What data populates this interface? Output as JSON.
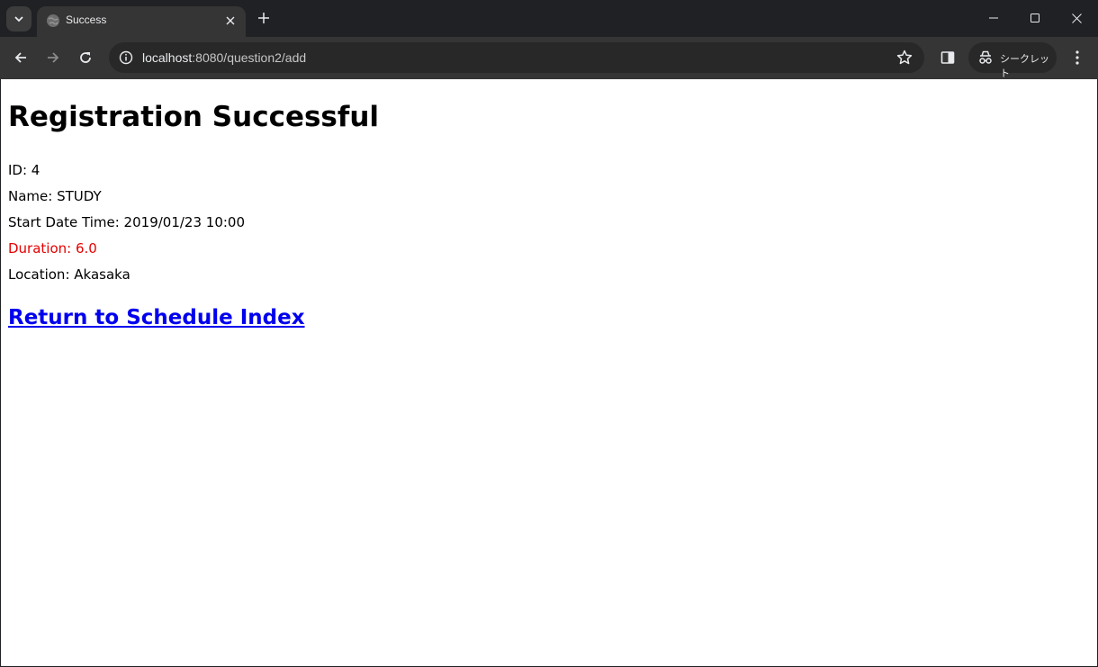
{
  "browser": {
    "tab": {
      "title": "Success",
      "favicon": "globe-icon",
      "close_icon": "close-icon"
    },
    "tab_search_icon": "chevron-down-icon",
    "new_tab_icon": "plus-icon",
    "window_controls": [
      "minimize-icon",
      "maximize-icon",
      "close-icon"
    ],
    "nav": {
      "back_icon": "arrow-left-icon",
      "forward_icon": "arrow-right-icon",
      "reload_icon": "reload-icon"
    },
    "address": {
      "host": "localhost",
      "rest": ":8080/question2/add",
      "info_icon": "info-icon",
      "star_icon": "star-icon"
    },
    "side_panel_icon": "side-panel-icon",
    "incognito_label": "シークレット",
    "incognito_icon": "incognito-icon",
    "menu_icon": "more-vert-icon"
  },
  "page": {
    "title": "Registration Successful",
    "fields": [
      {
        "text": "ID: 4"
      },
      {
        "text": "Name: STUDY"
      },
      {
        "text": "Start Date Time: 2019/01/23 10:00"
      },
      {
        "text": "Duration: 6.0",
        "color": "#e60000"
      },
      {
        "text": "Location: Akasaka"
      }
    ],
    "return_link": "Return to Schedule Index"
  }
}
